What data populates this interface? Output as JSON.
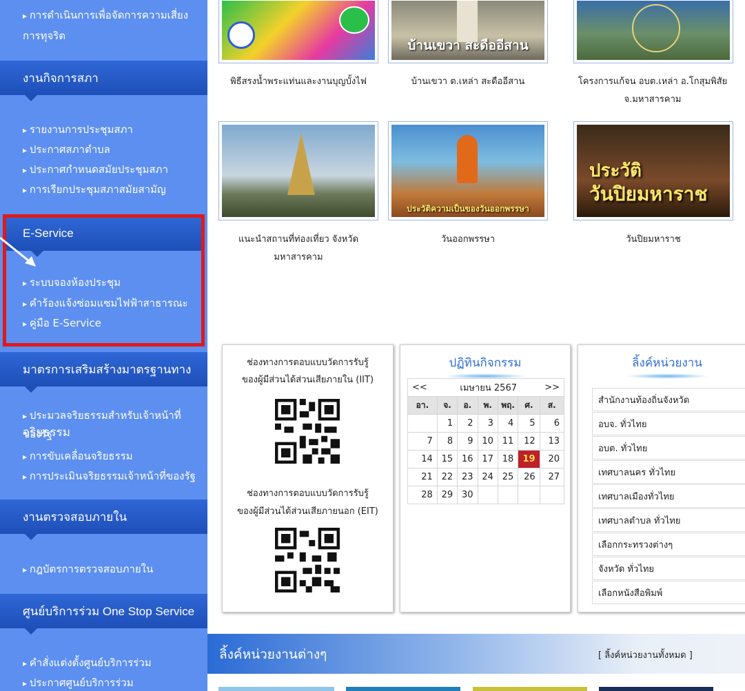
{
  "sidebar": {
    "top_item": {
      "line1": "การดำเนินการเพื่อจัดการความเสี่ยง",
      "line2": "การทุจริต"
    },
    "section_council": {
      "title": "งานกิจการสภา",
      "items": [
        "รายงานการประชุมสภา",
        "ประกาศสภาตำบล",
        "ประกาศกำหนดสมัยประชุมสภา",
        "การเรียกประชุมสภาสมัยสามัญ"
      ]
    },
    "section_eservice": {
      "title": "E-Service",
      "items": [
        "ระบบจองห้องประชุม",
        "คำร้องแจ้งซ่อมแซมไฟฟ้าสาธารณะ",
        "คู่มือ E-Service"
      ]
    },
    "section_ethics": {
      "title": "มาตรการเสริมสร้างมาตรฐานทาง",
      "title_overlap": "จริยธรรม",
      "item1_line1": "ประมวลจริยธรรมสำหรับเจ้าหน้าที่",
      "item1_line2": "ของรัฐ",
      "items": [
        "การขับเคลื่อนจริยธรรม",
        "การประเมินจริยธรรมเจ้าหน้าที่ของรัฐ"
      ]
    },
    "section_audit": {
      "title": "งานตรวจสอบภายใน",
      "items": [
        "กฎบัตรการตรวจสอบภายใน"
      ]
    },
    "section_onestop": {
      "title": "ศูนย์บริการร่วม One Stop Service",
      "items": [
        "คำสั่งแต่งตั้งศูนย์บริการร่วม",
        "ประกาศศูนย์บริการร่วม"
      ]
    }
  },
  "gallery": {
    "row1": [
      {
        "caption": "พิธีสรงน้ำพระแท่นและงานบุญบั้งไฟ",
        "badge_text": ""
      },
      {
        "caption": "บ้านเขวา ต.เหล่า สะดืออีสาน",
        "image_text": "บ้านเขวา สะดืออีสาน"
      },
      {
        "caption": "โครงการแก้จน อบต.เหล่า อ.โกสุมพิสัย จ.มหาสารคาม",
        "caption_line2": "จ.มหาสารคาม",
        "caption_line1": "โครงการแก้จน อบต.เหล่า อ.โกสุมพิสัย",
        "image_text": ""
      }
    ],
    "row2": [
      {
        "caption_line1": "แนะนำสถานที่ท่องเที่ยว จังหวัด",
        "caption_line2": "มหาสารคาม"
      },
      {
        "caption": "วันออกพรรษา",
        "image_text": "ประวัติความเป็นของวันออกพรรษา"
      },
      {
        "caption": "วันปิยมหาราช",
        "image_text_1": "ประวัติ",
        "image_text_2": "วันปิยมหาราช"
      }
    ]
  },
  "survey_panel": {
    "iit_line1": "ช่องทางการตอบแบบวัดการรับรู้",
    "iit_line2": "ของผู้มีส่วนได้ส่วนเสียภายใน (IIT)",
    "eit_line1": "ช่องทางการตอบแบบวัดการรับรู้",
    "eit_line2": "ของผู้มีส่วนได้ส่วนเสียภายนอก (EIT)"
  },
  "calendar": {
    "title": "ปฏิทินกิจกรรม",
    "prev": "<<",
    "next": ">>",
    "month": "เมษายน 2567",
    "weekdays": [
      "อา.",
      "จ.",
      "อ.",
      "พ.",
      "พฤ.",
      "ศ.",
      "ส."
    ],
    "weeks": [
      [
        "",
        "1",
        "2",
        "3",
        "4",
        "5",
        "6"
      ],
      [
        "7",
        "8",
        "9",
        "10",
        "11",
        "12",
        "13"
      ],
      [
        "14",
        "15",
        "16",
        "17",
        "18",
        "19",
        "20"
      ],
      [
        "21",
        "22",
        "23",
        "24",
        "25",
        "26",
        "27"
      ],
      [
        "28",
        "29",
        "30",
        "",
        "",
        "",
        ""
      ]
    ],
    "today": "19",
    "today_color": "#c0202a"
  },
  "links_panel": {
    "title": "ลิ้งค์หน่วยงาน",
    "items": [
      "สำนักงานท้องถิ่นจังหวัด",
      "อบจ. ทั่วไทย",
      "อบต. ทั่วไทย",
      "เทศบาลนคร ทั่วไทย",
      "เทศบาลเมืองทั่วไทย",
      "เทศบาลตำบล ทั่วไทย",
      "เลือกกระทรวงต่างๆ",
      "จังหวัด ทั่วไทย",
      "เลือกหนังสือพิมพ์"
    ]
  },
  "bottom": {
    "title": "ลิ้งค์หน่วยงานต่างๆ",
    "all_link": "[ ลิ้งค์หน่วยงานทั้งหมด ]"
  },
  "colors": {
    "sidebar_bg": "#5c8ff0",
    "section_header": "#1e4fb8",
    "highlight_box": "#e01a1a",
    "accent": "#2f6fd6"
  }
}
